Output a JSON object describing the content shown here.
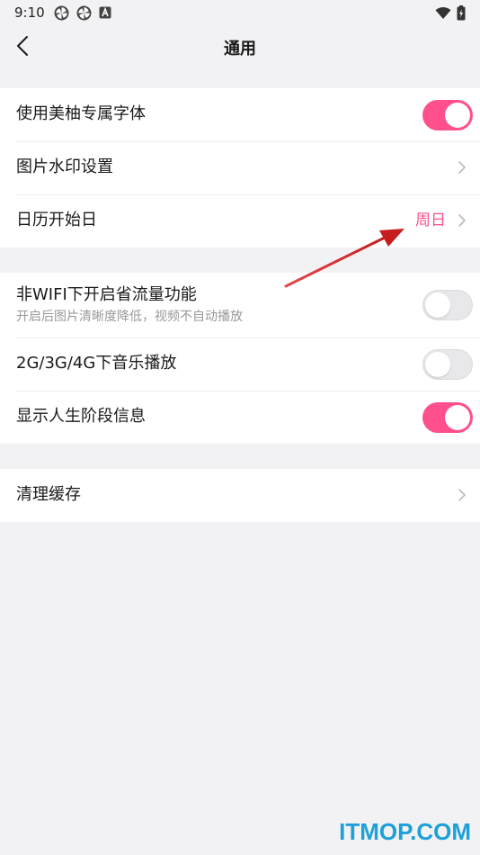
{
  "status_bar": {
    "time": "9:10"
  },
  "header": {
    "title": "通用"
  },
  "sections": {
    "first": {
      "custom_font": {
        "label": "使用美柚专属字体",
        "enabled": true
      },
      "watermark_settings": {
        "label": "图片水印设置"
      },
      "calendar_start": {
        "label": "日历开始日",
        "value": "周日"
      }
    },
    "second": {
      "data_saver": {
        "label": "非WIFI下开启省流量功能",
        "sub": "开启后图片清晰度降低，视频不自动播放",
        "enabled": false
      },
      "mobile_music": {
        "label": "2G/3G/4G下音乐播放",
        "enabled": false
      },
      "life_stage": {
        "label": "显示人生阶段信息",
        "enabled": true
      }
    },
    "third": {
      "clear_cache": {
        "label": "清理缓存"
      }
    }
  },
  "watermark": {
    "text": "ITMOP.COM"
  },
  "colors": {
    "accent": "#ff4f8d",
    "background": "#f2f2f4",
    "watermark": "#1ea0d8",
    "annotation_arrow": "#d62a2a"
  }
}
